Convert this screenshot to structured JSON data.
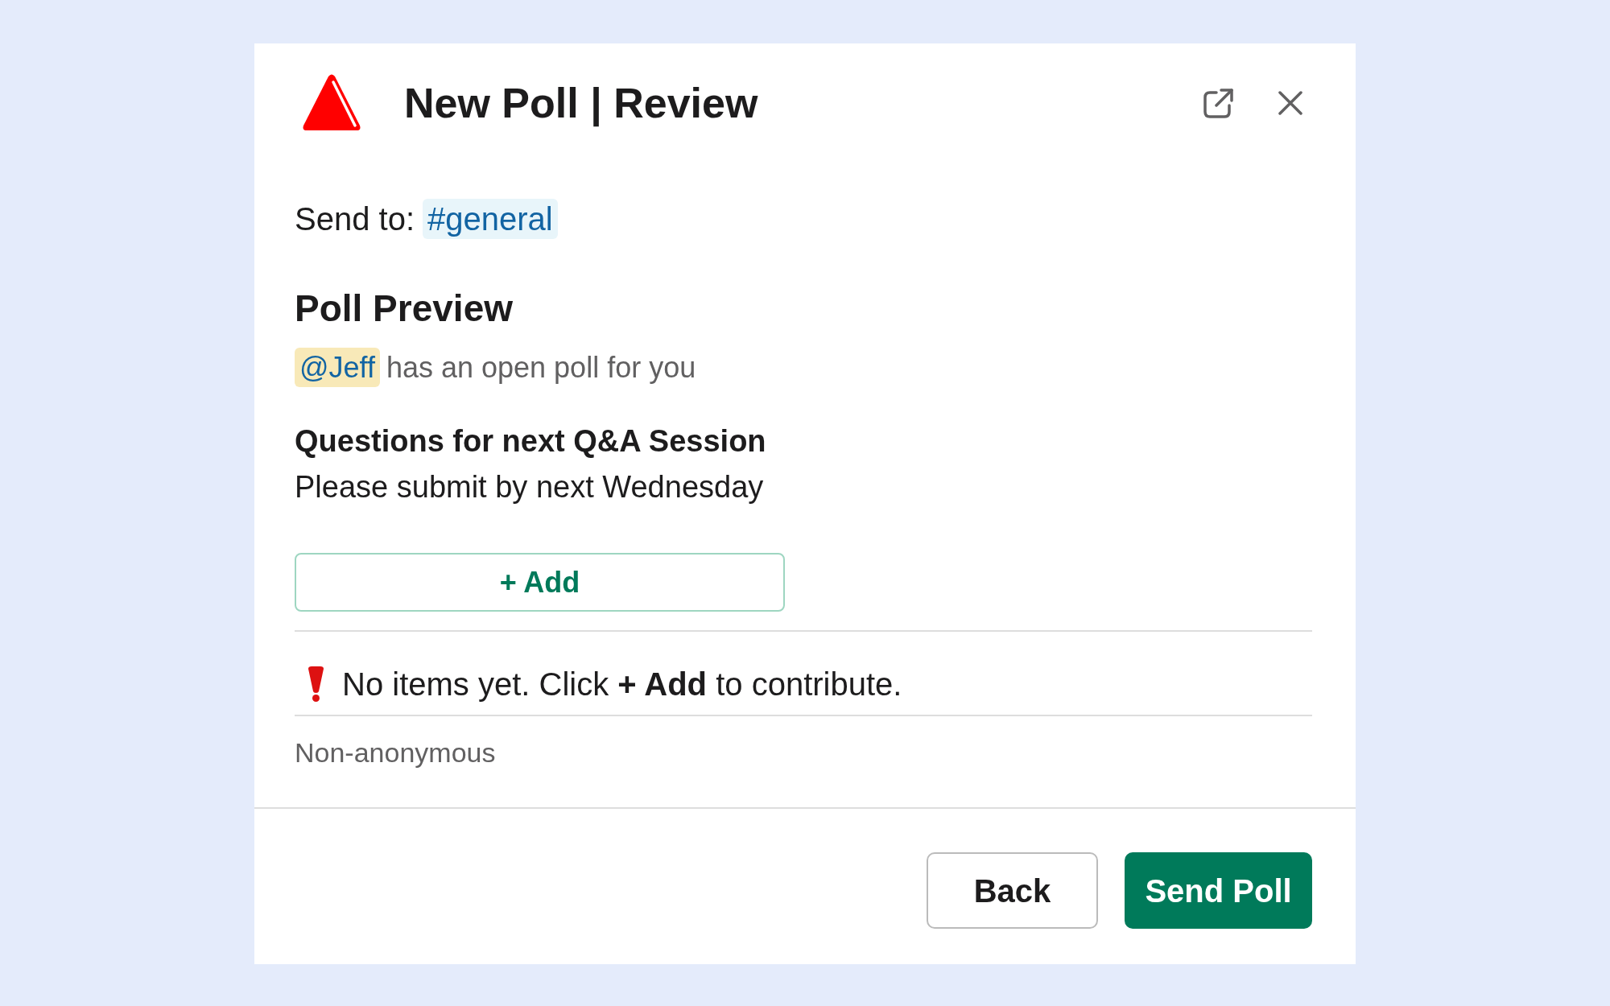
{
  "dialog": {
    "title": "New Poll | Review"
  },
  "send_to": {
    "label": "Send to:",
    "channel": "#general"
  },
  "preview": {
    "heading": "Poll Preview",
    "mention": "@Jeff",
    "mention_text": "has an open poll for you",
    "poll_title": "Questions for next Q&A Session",
    "poll_description": "Please submit by next Wednesday",
    "add_button": "+ Add",
    "notice": "No items yet. Click **+ Add** to contribute.",
    "anonymity": "Non-anonymous"
  },
  "footer": {
    "buttons": [
      {
        "label": "Back",
        "kind": "secondary"
      },
      {
        "label": "Send Poll",
        "kind": "primary"
      }
    ]
  }
}
